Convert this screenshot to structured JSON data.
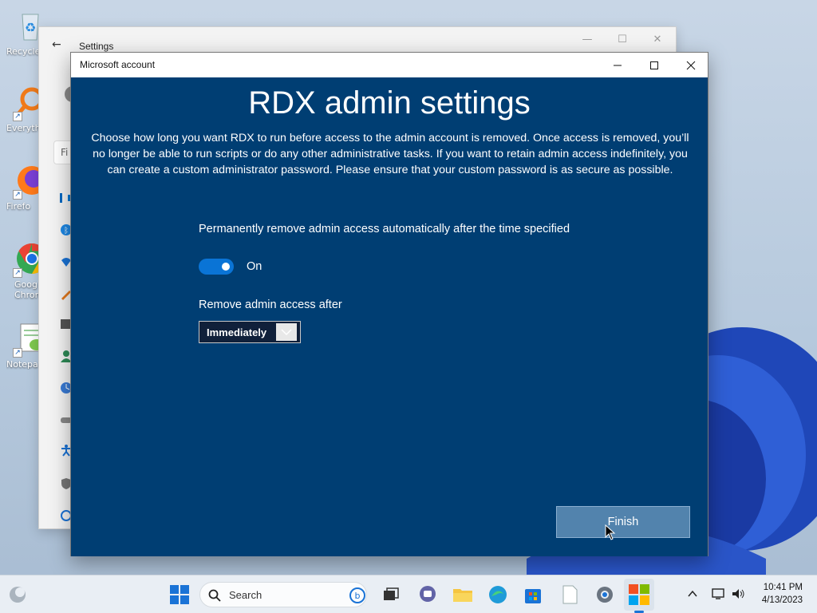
{
  "desktop": {
    "icons": [
      {
        "label": "Recycle"
      },
      {
        "label": "Everyth"
      },
      {
        "label": "Firefo"
      },
      {
        "label": "Goog Chron"
      },
      {
        "label": "Notepa"
      }
    ]
  },
  "settings_window": {
    "title": "Settings",
    "search_placeholder": "Fi"
  },
  "dialog": {
    "title": "Microsoft account",
    "heading": "RDX admin settings",
    "intro": "Choose how long you want RDX to run before access to the admin account is removed. Once access is removed, you’ll no longer be able to run scripts or do any other administrative tasks. If you want to retain admin access indefinitely, you can create a custom administrator password. Please ensure that your custom password is as secure as possible.",
    "permanent_label": "Permanently remove admin access automatically after the time specified",
    "toggle_state": "On",
    "remove_after_label": "Remove admin access after",
    "remove_after_value": "Immediately",
    "finish_label": "Finish"
  },
  "taskbar": {
    "search_label": "Search",
    "time": "10:41 PM",
    "date": "4/13/2023"
  },
  "colors": {
    "dialog_bg": "#003e73",
    "toggle_on": "#0a74d6",
    "finish_bg": "#5283ad"
  }
}
